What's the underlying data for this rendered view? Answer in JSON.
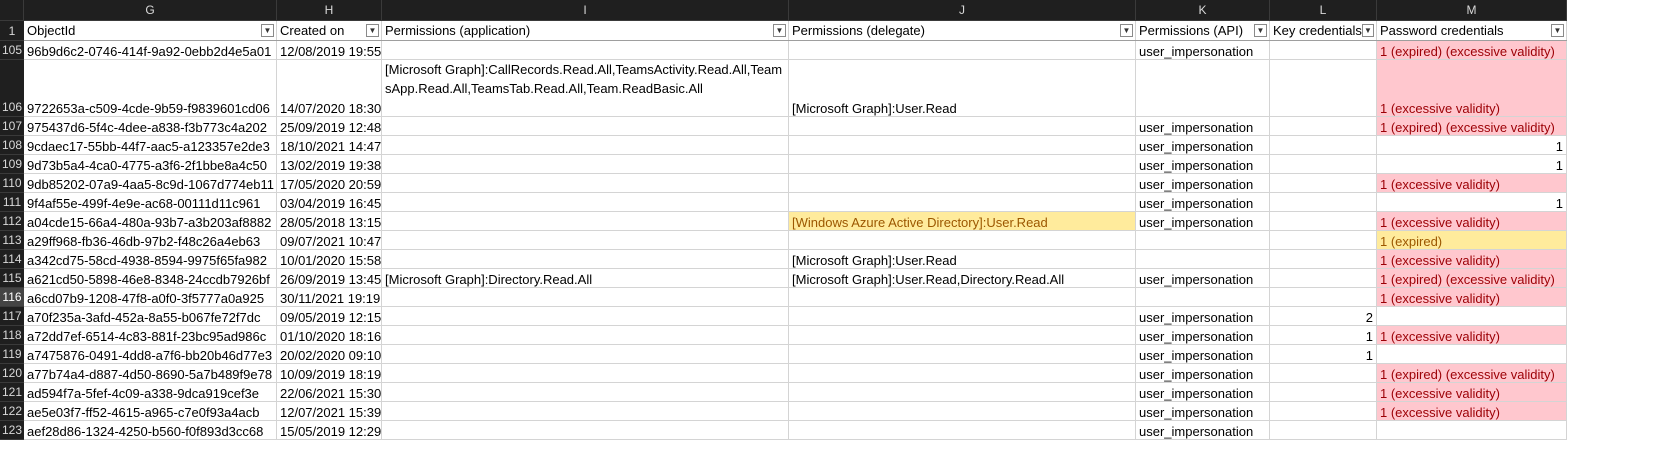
{
  "column_letters": [
    "G",
    "H",
    "I",
    "J",
    "K",
    "L",
    "M"
  ],
  "headers": [
    "ObjectId",
    "Created on",
    "Permissions (application)",
    "Permissions (delegate)",
    "Permissions (API)",
    "Key credentials",
    "Password credentials"
  ],
  "header_row_number": "1",
  "rows": [
    {
      "n": "105",
      "id": "96b9d6c2-0746-414f-9a92-0ebb2d4e5a01",
      "created": "12/08/2019 19:55",
      "app": "",
      "delegate": "",
      "api": "user_impersonation",
      "key": "",
      "pwd": "1 (expired) (excessive validity)",
      "pwd_style": "red",
      "del_style": ""
    },
    {
      "n": "106",
      "id": "9722653a-c509-4cde-9b59-f9839601cd06",
      "created": "14/07/2020 18:30",
      "app": "[Microsoft Graph]:CallRecords.Read.All,TeamsActivity.Read.All,TeamsApp.Read.All,TeamsTab.Read.All,Team.ReadBasic.All",
      "delegate": "[Microsoft Graph]:User.Read",
      "api": "",
      "key": "",
      "pwd": "1 (excessive validity)",
      "pwd_style": "red",
      "del_style": "",
      "tall": true
    },
    {
      "n": "107",
      "id": "975437d6-5f4c-4dee-a838-f3b773c4a202",
      "created": "25/09/2019 12:48",
      "app": "",
      "delegate": "",
      "api": "user_impersonation",
      "key": "",
      "pwd": "1 (expired) (excessive validity)",
      "pwd_style": "red",
      "del_style": ""
    },
    {
      "n": "108",
      "id": "9cdaec17-55bb-44f7-aac5-a123357e2de3",
      "created": "18/10/2021 14:47",
      "app": "",
      "delegate": "",
      "api": "user_impersonation",
      "key": "",
      "pwd": "1",
      "pwd_style": "num",
      "del_style": ""
    },
    {
      "n": "109",
      "id": "9d73b5a4-4ca0-4775-a3f6-2f1bbe8a4c50",
      "created": "13/02/2019 19:38",
      "app": "",
      "delegate": "",
      "api": "user_impersonation",
      "key": "",
      "pwd": "1",
      "pwd_style": "num",
      "del_style": ""
    },
    {
      "n": "110",
      "id": "9db85202-07a9-4aa5-8c9d-1067d774eb11",
      "created": "17/05/2020 20:59",
      "app": "",
      "delegate": "",
      "api": "user_impersonation",
      "key": "",
      "pwd": "1 (excessive validity)",
      "pwd_style": "red",
      "del_style": ""
    },
    {
      "n": "111",
      "id": "9f4af55e-499f-4e9e-ac68-00111d11c961",
      "created": "03/04/2019 16:45",
      "app": "",
      "delegate": "",
      "api": "user_impersonation",
      "key": "",
      "pwd": "1",
      "pwd_style": "num",
      "del_style": ""
    },
    {
      "n": "112",
      "id": "a04cde15-66a4-480a-93b7-a3b203af8882",
      "created": "28/05/2018 13:15",
      "app": "",
      "delegate": "[Windows Azure Active Directory]:User.Read",
      "api": "user_impersonation",
      "key": "",
      "pwd": "1 (excessive validity)",
      "pwd_style": "red",
      "del_style": "yellow"
    },
    {
      "n": "113",
      "id": "a29ff968-fb36-46db-97b2-f48c26a4eb63",
      "created": "09/07/2021 10:47",
      "app": "",
      "delegate": "",
      "api": "",
      "key": "",
      "pwd": "1 (expired)",
      "pwd_style": "yellow",
      "del_style": ""
    },
    {
      "n": "114",
      "id": "a342cd75-58cd-4938-8594-9975f65fa982",
      "created": "10/01/2020 15:58",
      "app": "",
      "delegate": "[Microsoft Graph]:User.Read",
      "api": "",
      "key": "",
      "pwd": "1 (excessive validity)",
      "pwd_style": "red",
      "del_style": ""
    },
    {
      "n": "115",
      "id": "a621cd50-5898-46e8-8348-24ccdb7926bf",
      "created": "26/09/2019 13:45",
      "app": "[Microsoft Graph]:Directory.Read.All",
      "delegate": "[Microsoft Graph]:User.Read,Directory.Read.All",
      "api": "user_impersonation",
      "key": "",
      "pwd": "1 (expired) (excessive validity)",
      "pwd_style": "red",
      "del_style": ""
    },
    {
      "n": "116",
      "id": "a6cd07b9-1208-47f8-a0f0-3f5777a0a925",
      "created": "30/11/2021 19:19",
      "app": "",
      "delegate": "",
      "api": "",
      "key": "",
      "pwd": "1 (excessive validity)",
      "pwd_style": "red",
      "del_style": "",
      "selected": true
    },
    {
      "n": "117",
      "id": "a70f235a-3afd-452a-8a55-b067fe72f7dc",
      "created": "09/05/2019 12:15",
      "app": "",
      "delegate": "",
      "api": "user_impersonation",
      "key": "2",
      "pwd": "",
      "pwd_style": "",
      "del_style": ""
    },
    {
      "n": "118",
      "id": "a72dd7ef-6514-4c83-881f-23bc95ad986c",
      "created": "01/10/2020 18:16",
      "app": "",
      "delegate": "",
      "api": "user_impersonation",
      "key": "1",
      "pwd": "1 (excessive validity)",
      "pwd_style": "red",
      "del_style": ""
    },
    {
      "n": "119",
      "id": "a7475876-0491-4dd8-a7f6-bb20b46d77e3",
      "created": "20/02/2020 09:10",
      "app": "",
      "delegate": "",
      "api": "user_impersonation",
      "key": "1",
      "pwd": "",
      "pwd_style": "",
      "del_style": ""
    },
    {
      "n": "120",
      "id": "a77b74a4-d887-4d50-8690-5a7b489f9e78",
      "created": "10/09/2019 18:19",
      "app": "",
      "delegate": "",
      "api": "user_impersonation",
      "key": "",
      "pwd": "1 (expired) (excessive validity)",
      "pwd_style": "red",
      "del_style": ""
    },
    {
      "n": "121",
      "id": "ad594f7a-5fef-4c09-a338-9dca919cef3e",
      "created": "22/06/2021 15:30",
      "app": "",
      "delegate": "",
      "api": "user_impersonation",
      "key": "",
      "pwd": "1 (excessive validity)",
      "pwd_style": "red",
      "del_style": ""
    },
    {
      "n": "122",
      "id": "ae5e03f7-ff52-4615-a965-c7e0f93a4acb",
      "created": "12/07/2021 15:39",
      "app": "",
      "delegate": "",
      "api": "user_impersonation",
      "key": "",
      "pwd": "1 (excessive validity)",
      "pwd_style": "red",
      "del_style": ""
    },
    {
      "n": "123",
      "id": "aef28d86-1324-4250-b560-f0f893d3cc68",
      "created": "15/05/2019 12:29",
      "app": "",
      "delegate": "",
      "api": "user_impersonation",
      "key": "",
      "pwd": "",
      "pwd_style": "",
      "del_style": ""
    }
  ],
  "colors": {
    "bad_fill": "#ffc7ce",
    "bad_text": "#9c0006",
    "neutral_fill": "#ffeb9c",
    "neutral_text": "#9c5700",
    "header_bg": "#1f1f1f"
  }
}
